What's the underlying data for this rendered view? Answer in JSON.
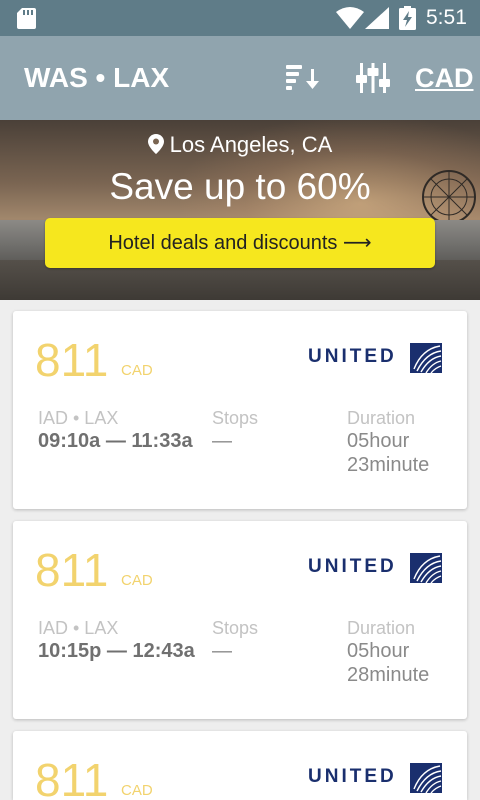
{
  "status_bar": {
    "time": "5:51",
    "icons": [
      "sd-card-icon",
      "wifi-icon",
      "cell-signal-icon",
      "battery-charging-icon"
    ]
  },
  "toolbar": {
    "title": "WAS • LAX",
    "sort_icon": "sort-descending-icon",
    "filter_icon": "filter-sliders-icon",
    "currency": "CAD"
  },
  "banner": {
    "location_icon": "location-pin-icon",
    "location": "Los Angeles, CA",
    "headline": "Save up to 60%",
    "cta": "Hotel deals and discounts ⟶"
  },
  "labels": {
    "stops": "Stops",
    "duration": "Duration"
  },
  "flights": [
    {
      "price": "811",
      "currency": "CAD",
      "airline": "UNITED",
      "route": "IAD • LAX",
      "times": "09:10a — 11:33a",
      "stops": "—",
      "duration_hours": "05hour",
      "duration_minutes": "23minute"
    },
    {
      "price": "811",
      "currency": "CAD",
      "airline": "UNITED",
      "route": "IAD • LAX",
      "times": "10:15p — 12:43a",
      "stops": "—",
      "duration_hours": "05hour",
      "duration_minutes": "28minute"
    },
    {
      "price": "811",
      "currency": "CAD",
      "airline": "UNITED",
      "route": "",
      "times": "",
      "stops": "",
      "duration_hours": "",
      "duration_minutes": ""
    }
  ],
  "colors": {
    "status_bar": "#5f7c88",
    "toolbar": "#90a4ae",
    "price": "#f2d36e",
    "cta": "#f6e71e",
    "airline_brand": "#1a2f6e"
  }
}
